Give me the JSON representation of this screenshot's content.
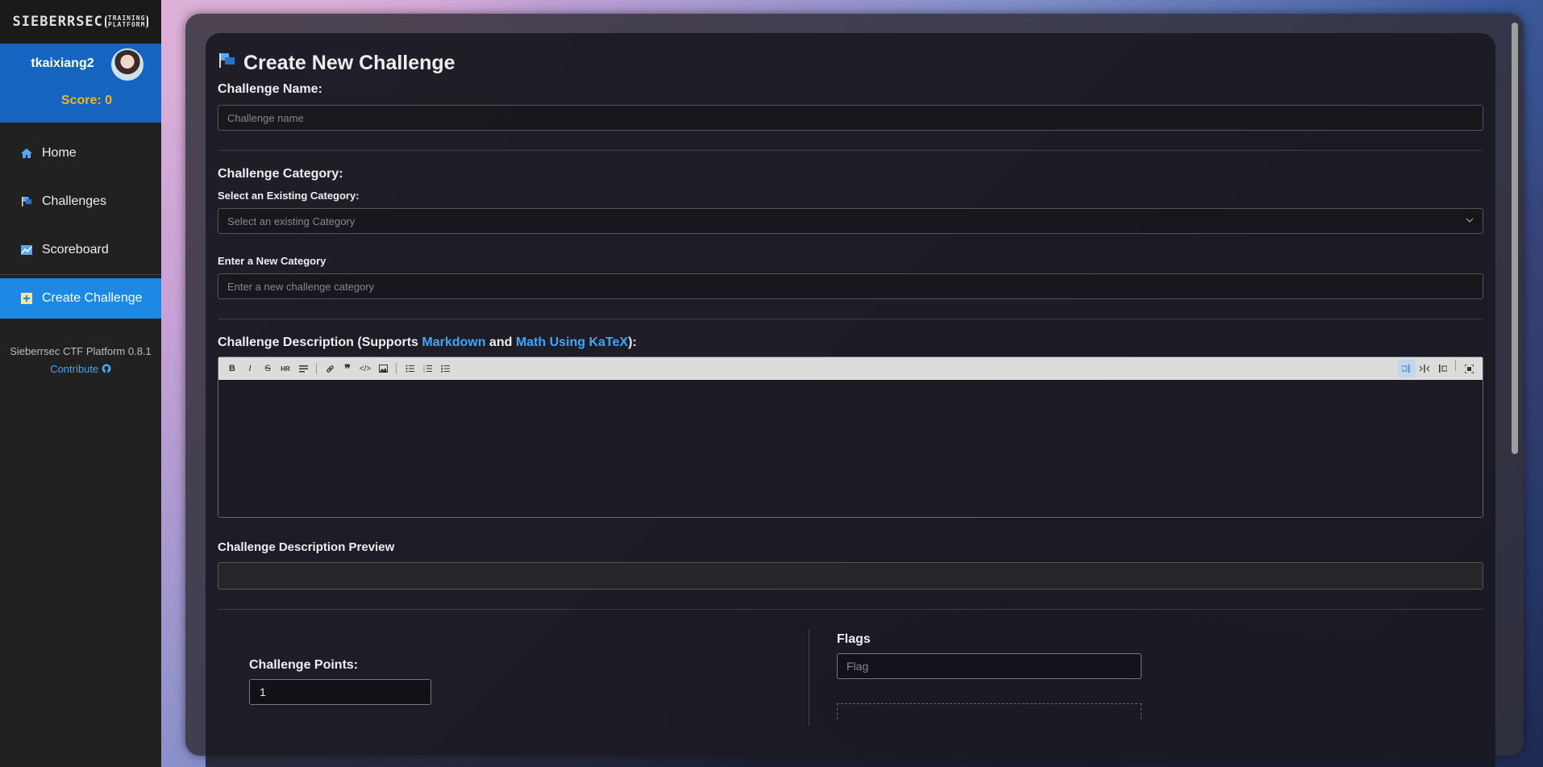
{
  "app": {
    "logo_main": "SIEBERRSEC",
    "logo_sub_top": "TRAINING",
    "logo_sub_bottom": "PLATFORM"
  },
  "user": {
    "name": "tkaixiang2",
    "score_label": "Score: 0"
  },
  "sidebar": {
    "items": [
      {
        "label": "Home",
        "icon": "home-icon"
      },
      {
        "label": "Challenges",
        "icon": "flag-icon"
      },
      {
        "label": "Scoreboard",
        "icon": "chart-icon"
      },
      {
        "label": "Create Challenge",
        "icon": "plus-square-icon",
        "active": true
      }
    ],
    "version": "Sieberrsec CTF Platform 0.8.1",
    "contribute": "Contribute"
  },
  "form": {
    "title": "Create New Challenge",
    "name_label": "Challenge Name:",
    "name_placeholder": "Challenge name",
    "category_label": "Challenge Category:",
    "existing_category_label": "Select an Existing Category:",
    "existing_category_placeholder": "Select an existing Category",
    "new_category_label": "Enter a New Category",
    "new_category_placeholder": "Enter a new challenge category",
    "description_label_prefix": "Challenge Description (Supports ",
    "description_link_markdown": "Markdown",
    "description_and": " and ",
    "description_link_katex": "Math Using KaTeX",
    "description_label_suffix": "):",
    "preview_label": "Challenge Description Preview",
    "points_label": "Challenge Points:",
    "points_value": "1",
    "flags_label": "Flags",
    "flag_placeholder": "Flag"
  },
  "toolbar": {
    "buttons": [
      "B",
      "I",
      "S",
      "HR",
      "H",
      "link",
      "quote",
      "code",
      "image",
      "ul",
      "ol",
      "checklist"
    ],
    "right_buttons": [
      "preview",
      "split",
      "edit",
      "fullscreen"
    ]
  },
  "colors": {
    "sidebar_bg": "#212121",
    "user_card_bg": "#1565c0",
    "active_nav": "#1e88e5",
    "score": "#f5b324",
    "link": "#42a5f5"
  }
}
